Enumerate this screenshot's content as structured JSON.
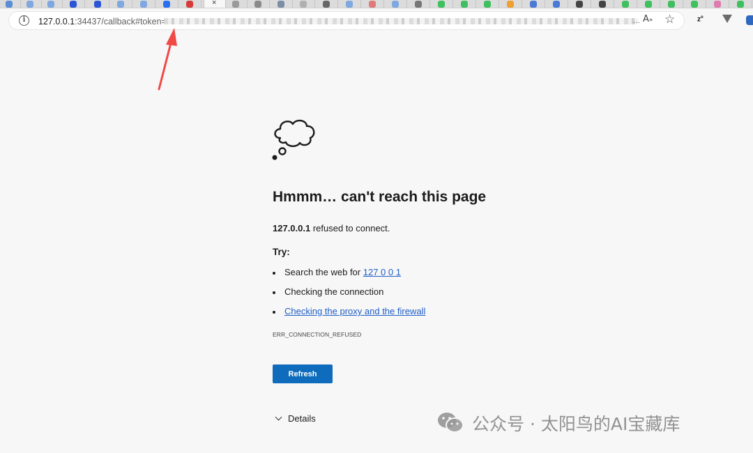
{
  "browser": {
    "tabs": [
      {
        "icon": "tab-favicon",
        "color": "#5b8dd6"
      },
      {
        "icon": "tab-favicon",
        "color": "#7fa7e0"
      },
      {
        "icon": "tab-favicon",
        "color": "#7fa7e0"
      },
      {
        "icon": "tab-favicon",
        "color": "#2a55d6"
      },
      {
        "icon": "tab-favicon",
        "color": "#2a55d6"
      },
      {
        "icon": "tab-favicon",
        "color": "#7fa7e0"
      },
      {
        "icon": "tab-favicon",
        "color": "#7fa7e0"
      },
      {
        "icon": "tab-favicon",
        "color": "#2a6ff0"
      },
      {
        "icon": "tab-favicon",
        "color": "#d63a3a"
      }
    ],
    "active_tab_close": "×",
    "address": {
      "host": "127.0.0.1",
      "rest": ":34437/callback#token=",
      "trailing": "..."
    }
  },
  "page": {
    "title": "Hmmm… can't reach this page",
    "host_bold": "127.0.0.1",
    "refused_text": " refused to connect.",
    "try_label": "Try:",
    "suggestions": {
      "search_prefix": "Search the web for ",
      "search_link": "127 0 0 1",
      "check_connection": "Checking the connection",
      "proxy_link": "Checking the proxy and the firewall"
    },
    "error_code": "ERR_CONNECTION_REFUSED",
    "refresh_label": "Refresh",
    "details_label": "Details"
  },
  "watermark": {
    "text": "公众号 · 太阳鸟的AI宝藏库"
  },
  "colors": {
    "accent": "#0f6cbd",
    "link": "#1f5ec8",
    "arrow": "#f04a45"
  }
}
